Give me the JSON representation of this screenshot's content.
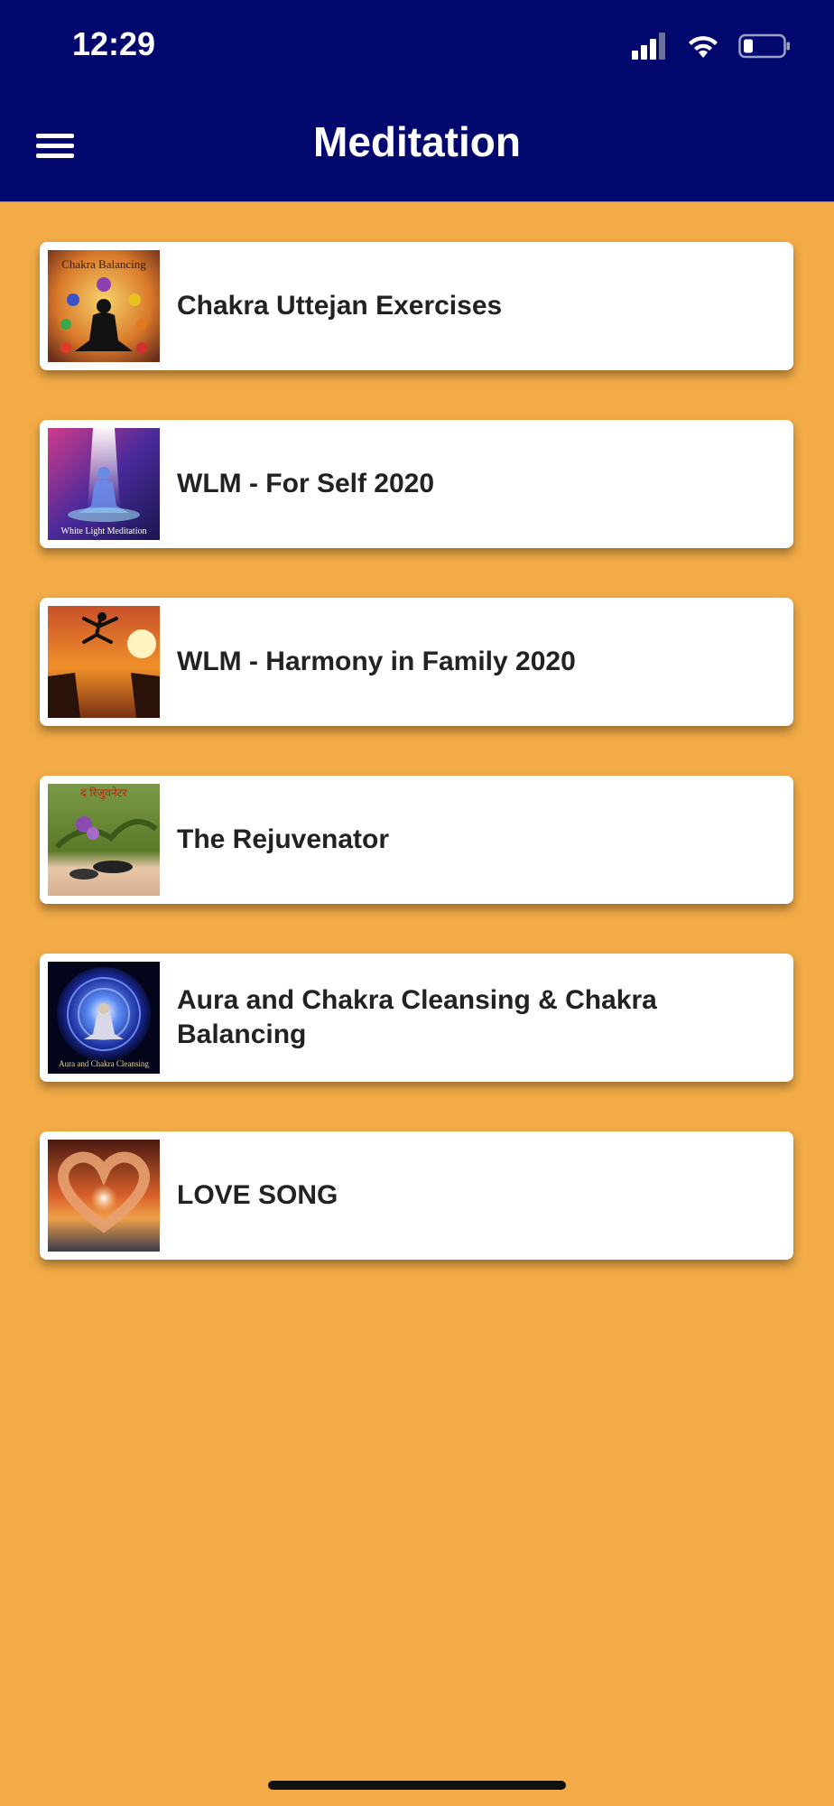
{
  "status_bar": {
    "time": "12:29"
  },
  "header": {
    "title": "Meditation"
  },
  "items": [
    {
      "label": "Chakra Uttejan Exercises",
      "thumb_caption": "Chakra Balancing"
    },
    {
      "label": "WLM - For Self 2020",
      "thumb_caption": "White Light Meditation"
    },
    {
      "label": "WLM - Harmony in Family 2020",
      "thumb_caption": ""
    },
    {
      "label": "The Rejuvenator",
      "thumb_caption": "द रिजुवनेटर"
    },
    {
      "label": "Aura and Chakra Cleansing & Chakra Balancing",
      "thumb_caption": "Aura and Chakra Cleansing"
    },
    {
      "label": "LOVE SONG",
      "thumb_caption": ""
    }
  ],
  "colors": {
    "header_bg": "#03086f",
    "page_bg": "#f2ab46",
    "card_bg": "#ffffff"
  }
}
